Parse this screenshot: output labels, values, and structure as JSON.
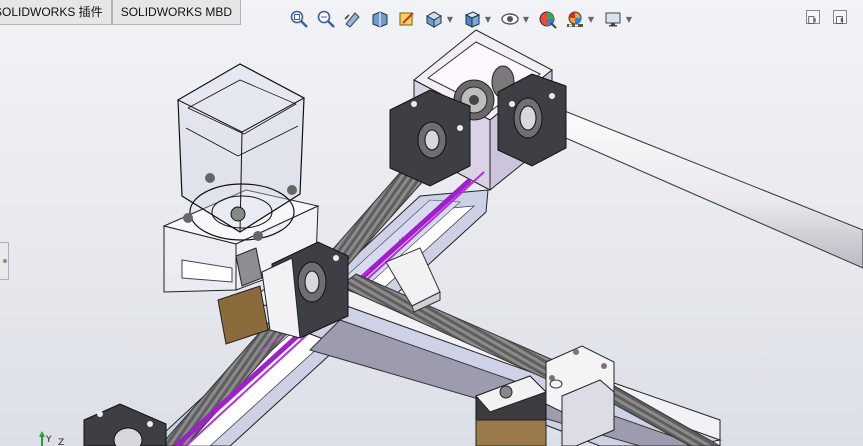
{
  "tabs": [
    {
      "label": "SOLIDWORKS 插件"
    },
    {
      "label": "SOLIDWORKS MBD"
    }
  ],
  "hud_icons": [
    "zoom-to-fit-icon",
    "zoom-to-area-icon",
    "previous-view-icon",
    "section-view-icon",
    "dynamic-annotation-icon",
    "view-orientation-icon",
    "display-style-icon",
    "hide-show-items-icon",
    "edit-appearance-icon",
    "apply-scene-icon",
    "view-settings-icon"
  ],
  "triad": {
    "y_label": "Y",
    "z_label": "Z"
  },
  "colors": {
    "frame": "#cfd3e6",
    "screw": "#7c7c7c",
    "bearing_block": "#3d3f44",
    "selection": "#a020c8",
    "motor_bracket": "#9a7a4a",
    "rod": "#f4f4f6"
  }
}
